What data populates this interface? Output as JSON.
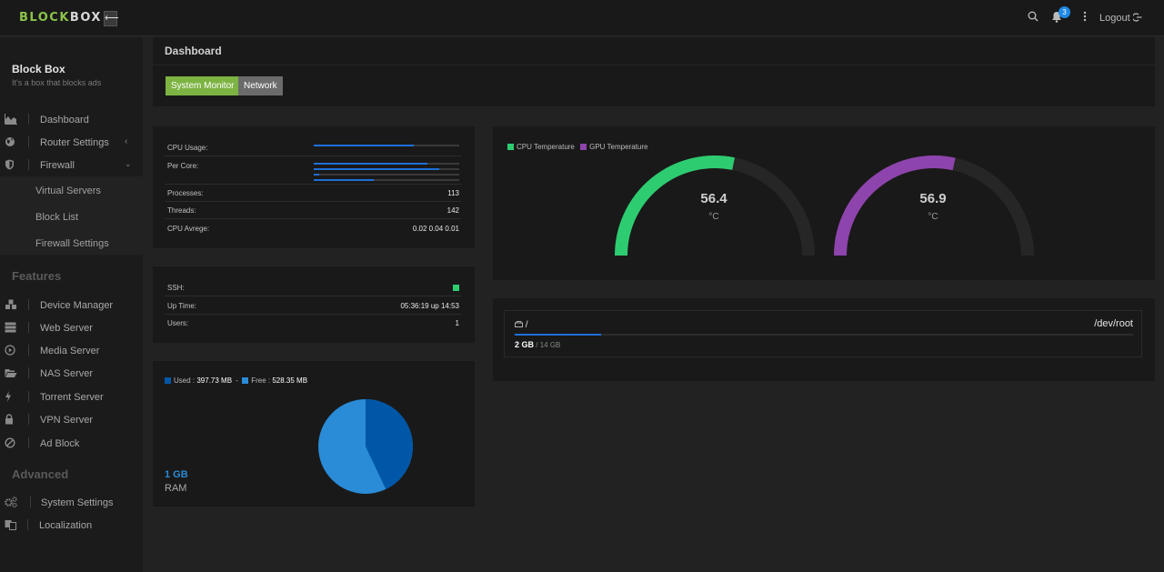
{
  "app": {
    "logo_part1": "BLOCK",
    "logo_part2": "BOX",
    "logout_label": "Logout",
    "notification_count": "3"
  },
  "sidebar": {
    "brand_title": "Block Box",
    "brand_subtitle": "It's a box that blocks ads",
    "main": [
      {
        "label": "Dashboard",
        "icon": "area-chart-icon"
      },
      {
        "label": "Router Settings",
        "icon": "globe-icon"
      },
      {
        "label": "Firewall",
        "icon": "shield-icon"
      }
    ],
    "firewall_sub": [
      "Virtual Servers",
      "Block List",
      "Firewall Settings"
    ],
    "features_heading": "Features",
    "features": [
      {
        "label": "Device Manager",
        "icon": "cubes-icon"
      },
      {
        "label": "Web Server",
        "icon": "server-icon"
      },
      {
        "label": "Media Server",
        "icon": "play-circle-icon"
      },
      {
        "label": "NAS Server",
        "icon": "folder-open-icon"
      },
      {
        "label": "Torrent Server",
        "icon": "bolt-icon"
      },
      {
        "label": "VPN Server",
        "icon": "lock-icon"
      },
      {
        "label": "Ad Block",
        "icon": "ban-icon"
      }
    ],
    "advanced_heading": "Advanced",
    "advanced": [
      {
        "label": "System Settings",
        "icon": "cogs-icon"
      },
      {
        "label": "Localization",
        "icon": "language-icon"
      }
    ]
  },
  "page": {
    "title": "Dashboard",
    "tabs": [
      "System Monitor",
      "Network"
    ]
  },
  "system": {
    "cpu_usage_label": "CPU Usage:",
    "cpu_usage_pct": 69,
    "per_core_label": "Per Core:",
    "per_core_pct": [
      78,
      86,
      4,
      41
    ],
    "processes_label": "Processes:",
    "processes": "113",
    "threads_label": "Threads:",
    "threads": "142",
    "cpu_avg_label": "CPU Avrege:",
    "cpu_avg": "0.02 0.04 0.01"
  },
  "status": {
    "ssh_label": "SSH:",
    "uptime_label": "Up Time:",
    "uptime": "05:36:19 up 14:53",
    "users_label": "Users:",
    "users": "1"
  },
  "ram": {
    "used_label": "Used :",
    "used": "397.73 MB",
    "free_label": "Free :",
    "free": "528.35 MB",
    "total": "1 GB",
    "label": "RAM"
  },
  "temps": {
    "cpu_label": "CPU Temperature",
    "gpu_label": "GPU Temperature",
    "cpu_value": "56.4",
    "gpu_value": "56.9",
    "unit": "°C",
    "gauge_max": 100,
    "colors": {
      "cpu": "#2ecc71",
      "gpu": "#8e44ad"
    }
  },
  "disk": {
    "path": "/",
    "device": "/dev/root",
    "used": "2 GB",
    "total": "/ 14 GB",
    "used_fraction": 0.14
  },
  "colors": {
    "accent": "#8bc34a",
    "bar": "#1e6fd9",
    "ram_used": "#0057a8",
    "ram_free": "#2a8bd6"
  }
}
